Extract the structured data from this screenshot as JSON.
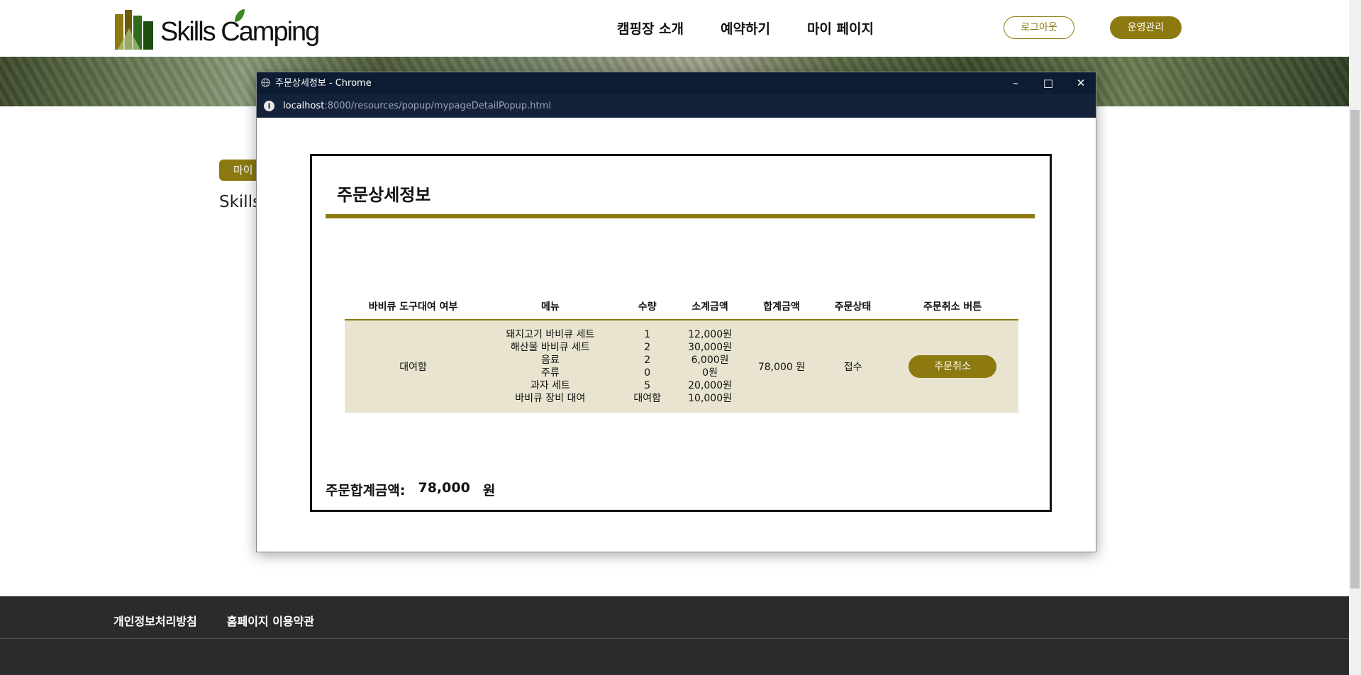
{
  "site": {
    "logo_text": "Skills Camping",
    "nav": [
      "캠핑장 소개",
      "예약하기",
      "마이 페이지"
    ],
    "logout_label": "로그아웃",
    "admin_label": "운영관리",
    "page_badge": "마이",
    "page_sub": "Skills",
    "footer_links": [
      "개인정보처리방침",
      "홈페이지 이용약관"
    ]
  },
  "popup": {
    "window_title": "주문상세정보 - Chrome",
    "url_host": "localhost",
    "url_path": ":8000/resources/popup/mypageDetailPopup.html",
    "heading": "주문상세정보",
    "columns": [
      "바비큐 도구대여 여부",
      "메뉴",
      "수량",
      "소계금액",
      "합계금액",
      "주문상태",
      "주문취소 버튼"
    ],
    "order": {
      "bbq_rental": "대여함",
      "items": [
        {
          "menu": "돼지고기 바비큐 세트",
          "qty": "1",
          "subtotal": "12,000원"
        },
        {
          "menu": "해산물 바비큐 세트",
          "qty": "2",
          "subtotal": "30,000원"
        },
        {
          "menu": "음료",
          "qty": "2",
          "subtotal": "6,000원"
        },
        {
          "menu": "주류",
          "qty": "0",
          "subtotal": "0원"
        },
        {
          "menu": "과자 세트",
          "qty": "5",
          "subtotal": "20,000원"
        },
        {
          "menu": "바비큐 장비 대여",
          "qty": "대여함",
          "subtotal": "10,000원"
        }
      ],
      "total": "78,000 원",
      "status": "접수",
      "cancel_label": "주문취소"
    },
    "total_label": "주문합계금액:",
    "total_amount": "78,000",
    "total_unit": "원"
  },
  "colors": {
    "accent": "#8c7a10",
    "row_bg": "#e9e4d0",
    "titlebar": "#0c1d33",
    "footer": "#2b2b2b"
  }
}
